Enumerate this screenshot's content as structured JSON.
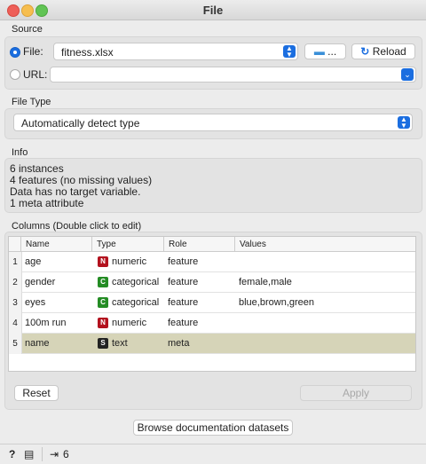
{
  "window": {
    "title": "File"
  },
  "source": {
    "section_label": "Source",
    "file_label": "File:",
    "file_value": "fitness.xlsx",
    "browse_label": "...",
    "reload_label": "Reload",
    "url_label": "URL:",
    "url_value": ""
  },
  "file_type": {
    "section_label": "File Type",
    "selected": "Automatically detect type"
  },
  "info": {
    "section_label": "Info",
    "lines": [
      "6 instances",
      "4 features (no missing values)",
      "Data has no target variable.",
      "1 meta attribute"
    ]
  },
  "columns": {
    "section_label": "Columns (Double click to edit)",
    "headers": [
      "Name",
      "Type",
      "Role",
      "Values"
    ],
    "rows": [
      {
        "num": "1",
        "name": "age",
        "type_badge": "N",
        "type_color": "#b3121e",
        "type": "numeric",
        "role": "feature",
        "values": ""
      },
      {
        "num": "2",
        "name": "gender",
        "type_badge": "C",
        "type_color": "#248c24",
        "type": "categorical",
        "role": "feature",
        "values": "female,male"
      },
      {
        "num": "3",
        "name": "eyes",
        "type_badge": "C",
        "type_color": "#248c24",
        "type": "categorical",
        "role": "feature",
        "values": "blue,brown,green"
      },
      {
        "num": "4",
        "name": "100m run",
        "type_badge": "N",
        "type_color": "#b3121e",
        "type": "numeric",
        "role": "feature",
        "values": ""
      },
      {
        "num": "5",
        "name": "name",
        "type_badge": "S",
        "type_color": "#222222",
        "type": "text",
        "role": "meta",
        "values": ""
      }
    ],
    "reset_label": "Reset",
    "apply_label": "Apply"
  },
  "browse_docs_label": "Browse documentation datasets",
  "status": {
    "output_count": "6"
  },
  "colors": {
    "accent": "#1b6ee0",
    "selected_row": "#d6d4b8"
  }
}
